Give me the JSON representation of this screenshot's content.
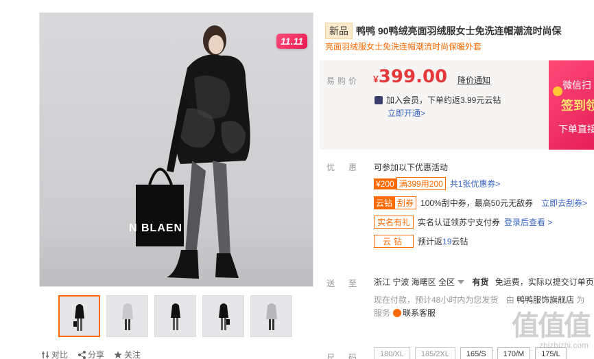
{
  "gallery": {
    "badge": "11.11",
    "model_text": "N BLAEN",
    "tools": [
      {
        "label": "对比",
        "icon": "compare-icon"
      },
      {
        "label": "分享",
        "icon": "share-icon"
      },
      {
        "label": "关注",
        "icon": "star-icon"
      }
    ]
  },
  "product": {
    "new_tag": "新品",
    "title": "鸭鸭 90鸭绒亮面羽绒服女士免洗连帽潮流时尚保",
    "subtitle": "亮面羽绒服女士免洗连帽潮流时尚保暖外套"
  },
  "price": {
    "label": "易购价",
    "currency": "¥",
    "value": "399.00",
    "notice": "降价通知",
    "vip_text": "加入会员，下单约返3.99元云钻",
    "vip_link": "立即开通>"
  },
  "promo_card": {
    "line1": "微信扫",
    "line2": "签到领",
    "line3": "下单直接"
  },
  "discount": {
    "label": "优惠",
    "intro": "可参加以下优惠活动",
    "coupon_amount": "¥200",
    "coupon_rule": "满399用200",
    "coupon_link": "共1张优惠券>",
    "scratch_tag1": "云钻",
    "scratch_tag2": "刮券",
    "scratch_text": "100%刮中券，最高50元无敌券",
    "scratch_link": "立即去刮券>",
    "realname_tag": "实名有礼",
    "realname_text": "实名认证领苏宁支付券",
    "realname_link": "登录后查看 >",
    "cloud_tag": "云钻",
    "cloud_text_prefix": "预计返",
    "cloud_value": "19",
    "cloud_text_suffix": "云钻"
  },
  "shipping": {
    "label": "送至",
    "location": "浙江 宁波 海曙区 全区",
    "stock": "有货",
    "free": "免运费，实际以提交订单页",
    "notice_prefix": "现在付款，预计48小时内为您发货",
    "by": "由",
    "shop": "鸭鸭服饰旗舰店",
    "from": "为",
    "service_label": "服务",
    "service": "联系客服"
  },
  "sizes": {
    "label": "尺码",
    "items": [
      "180/XL",
      "185/2XL",
      "165/S",
      "170/M",
      "175/L"
    ],
    "available": [
      false,
      false,
      true,
      true,
      true
    ]
  },
  "watermark": {
    "big": "值值值",
    "small": "zhizhizhi.com"
  },
  "colors": {
    "accent": "#ff6a00",
    "price": "#e5383b",
    "link": "#3a67c3"
  }
}
